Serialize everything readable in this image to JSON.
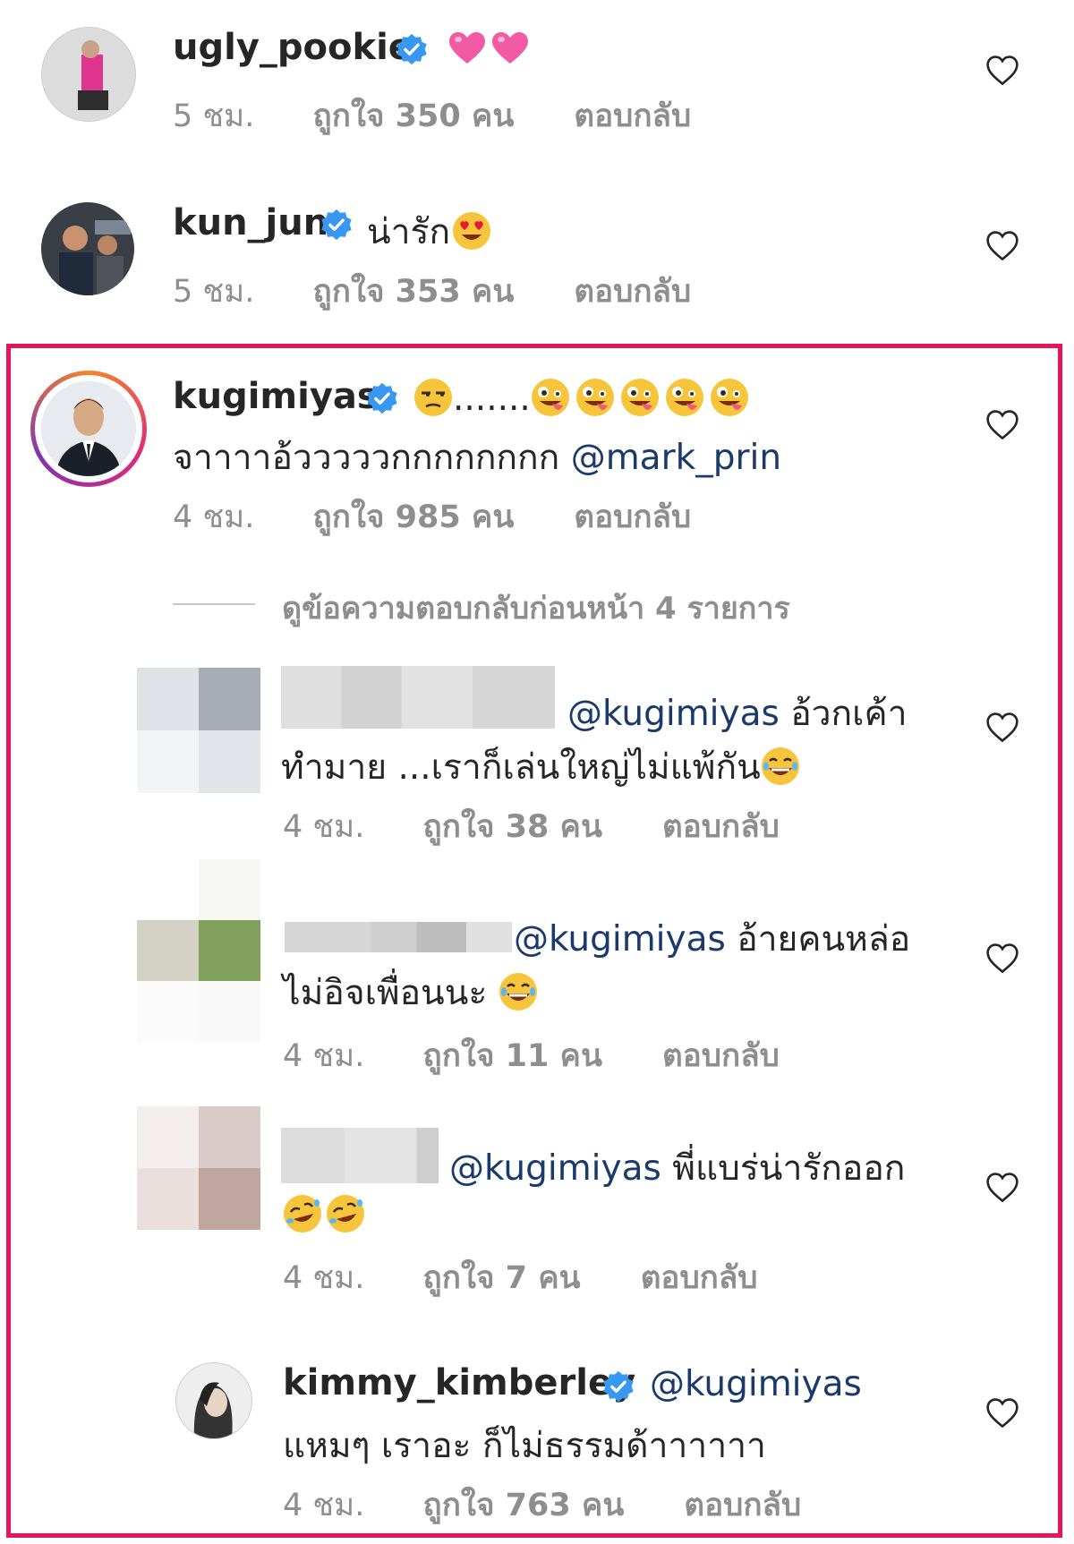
{
  "comments": [
    {
      "username": "ugly_pookie",
      "text_suffix": "",
      "time": "5 ชม.",
      "likes": "ถูกใจ 350 คน",
      "reply": "ตอบกลับ",
      "emojis": [
        "pink-heart",
        "pink-heart"
      ]
    },
    {
      "username": "kun_jun",
      "text": "น่ารัก",
      "time": "5 ชม.",
      "likes": "ถูกใจ 353 คน",
      "reply": "ตอบกลับ",
      "emojis": [
        "heart-eyes"
      ]
    },
    {
      "username": "kugimiyas",
      "text_dots": ".......",
      "line2": "จาาาาอ้วววววกกกกกกกก",
      "mention": "@mark_prin",
      "time": "4 ชม.",
      "likes": "ถูกใจ 985 คน",
      "reply": "ตอบกลับ",
      "emojis": [
        "unamused",
        "zany",
        "zany",
        "zany",
        "zany",
        "zany"
      ]
    }
  ],
  "view_previous": "ดูข้อความตอบกลับก่อนหน้า 4 รายการ",
  "replies": [
    {
      "mention": "@kugimiyas",
      "line1": "อ้วกเค้า",
      "line2": "ทำมาย ...เราก็เล่นใหญ่ไม่แพ้กัน",
      "time": "4 ชม.",
      "likes": "ถูกใจ 38 คน",
      "reply": "ตอบกลับ"
    },
    {
      "mention": "@kugimiyas",
      "line1": "อ้ายคนหล่อ",
      "line2": "ไม่อิจเพื่อนนะ",
      "time": "4 ชม.",
      "likes": "ถูกใจ 11 คน",
      "reply": "ตอบกลับ"
    },
    {
      "mention": "@kugimiyas",
      "line1": "พี่แบร่น่ารักออก",
      "line2": "",
      "time": "4 ชม.",
      "likes": "ถูกใจ 7 คน",
      "reply": "ตอบกลับ"
    },
    {
      "username": "kimmy_kimberley",
      "mention": "@kugimiyas",
      "line2": "แหมๆ เราอะ ก็ไม่ธรรมด้าาาาาา",
      "time": "4 ชม.",
      "likes": "ถูกใจ 763 คน",
      "reply": "ตอบกลับ"
    }
  ],
  "colors": {
    "highlight_border": "#e8155a",
    "mention": "#1a3a6b",
    "meta": "#8e8e8e",
    "verified": "#3897f0"
  }
}
